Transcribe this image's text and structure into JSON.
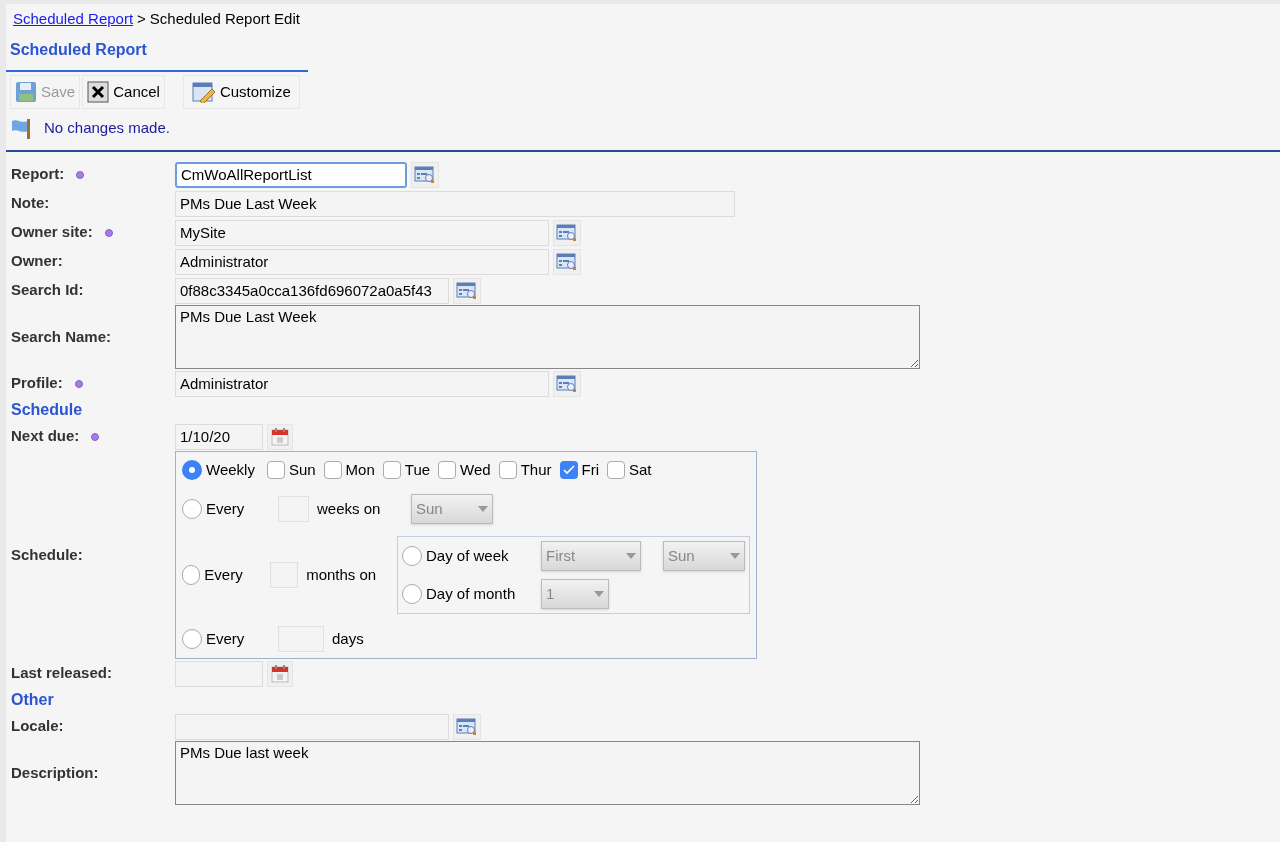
{
  "breadcrumb": {
    "link": "Scheduled Report",
    "separator": ">",
    "current": "Scheduled Report Edit"
  },
  "tab": {
    "label": "Scheduled Report"
  },
  "toolbar": [
    {
      "label": "Save",
      "kind": "save",
      "disabled": true
    },
    {
      "label": "Cancel",
      "kind": "cancel",
      "disabled": false
    },
    {
      "label": "Customize",
      "kind": "customize",
      "disabled": false
    }
  ],
  "message": "No changes made.",
  "rows": [
    {
      "kind": "lookup-short",
      "label": "Report:",
      "required": true,
      "value": "CmWoAllReportList",
      "focused": true
    },
    {
      "kind": "text",
      "label": "Note:",
      "required": false,
      "value": "PMs Due Last Week",
      "focused": false
    },
    {
      "kind": "lookup",
      "label": "Owner site:",
      "required": true,
      "value": "MySite",
      "focused": false
    },
    {
      "kind": "lookup",
      "label": "Owner:",
      "required": false,
      "value": "Administrator",
      "focused": false
    },
    {
      "kind": "lookup-narrow",
      "label": "Search Id:",
      "required": false,
      "value": "0f88c3345a0cca136fd696072a0a5f43",
      "focused": false
    },
    {
      "kind": "textarea",
      "label": "Search Name:",
      "required": false,
      "value": "PMs Due Last Week"
    },
    {
      "kind": "lookup",
      "label": "Profile:",
      "required": true,
      "value": "Administrator",
      "focused": false
    },
    {
      "kind": "section",
      "label": "Schedule"
    },
    {
      "kind": "date",
      "label": "Next due:",
      "required": true,
      "value": "1/10/20"
    },
    {
      "kind": "schedule",
      "label": "Schedule:"
    },
    {
      "kind": "date",
      "label": "Last released:",
      "required": false,
      "value": ""
    },
    {
      "kind": "section",
      "label": "Other"
    },
    {
      "kind": "lookup-narrow",
      "label": "Locale:",
      "required": false,
      "value": "",
      "focused": false
    },
    {
      "kind": "textarea",
      "label": "Description:",
      "required": false,
      "value": "PMs Due last week"
    }
  ],
  "schedule": {
    "weekly": {
      "label": "Weekly",
      "selected": true,
      "days": [
        {
          "label": "Sun",
          "checked": false
        },
        {
          "label": "Mon",
          "checked": false
        },
        {
          "label": "Tue",
          "checked": false
        },
        {
          "label": "Wed",
          "checked": false
        },
        {
          "label": "Thur",
          "checked": false
        },
        {
          "label": "Fri",
          "checked": true
        },
        {
          "label": "Sat",
          "checked": false
        }
      ]
    },
    "weeks": {
      "label": "Every",
      "selected": false,
      "unit": "weeks on",
      "day": "Sun"
    },
    "months": {
      "label": "Every",
      "selected": false,
      "unit": "months on",
      "day_of_week": {
        "label": "Day of week",
        "selected": false,
        "ordinal": "First",
        "day": "Sun"
      },
      "day_of_month": {
        "label": "Day of month",
        "selected": false,
        "day": "1"
      }
    },
    "days": {
      "label": "Every",
      "selected": false,
      "unit": "days"
    }
  }
}
